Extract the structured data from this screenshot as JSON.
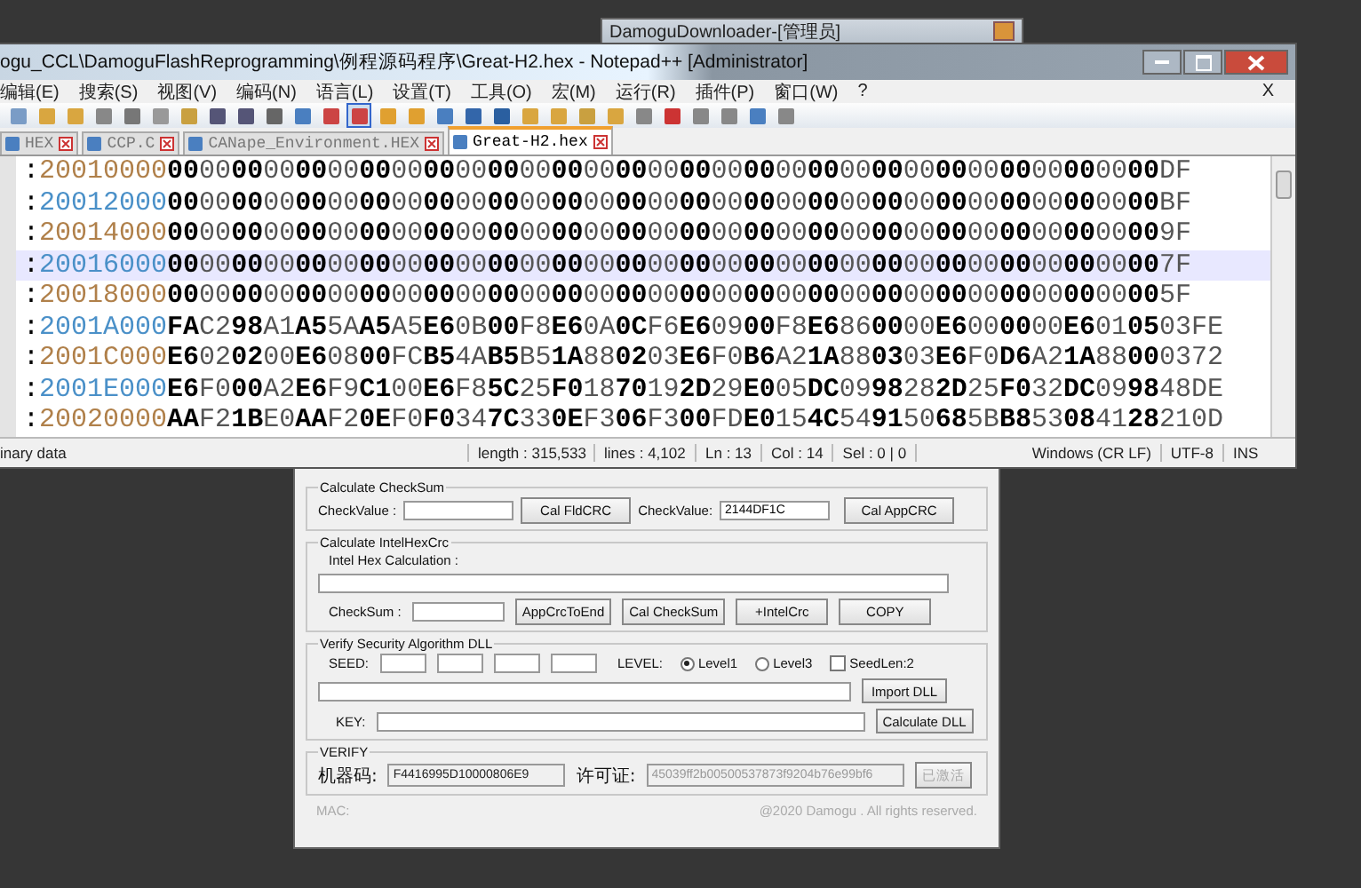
{
  "downloader_title": "DamoguDownloader-[管理员]",
  "notepad": {
    "title": "ogu_CCL\\DamoguFlashReprogramming\\例程源码程序\\Great-H2.hex - Notepad++ [Administrator]",
    "menu": [
      "编辑(E)",
      "搜索(S)",
      "视图(V)",
      "编码(N)",
      "语言(L)",
      "设置(T)",
      "工具(O)",
      "宏(M)",
      "运行(R)",
      "插件(P)",
      "窗口(W)",
      "?"
    ],
    "close_menu": "X",
    "tabs": [
      {
        "label": "HEX",
        "selected": false
      },
      {
        "label": "CCP.C",
        "selected": false
      },
      {
        "label": "CANape_Environment.HEX",
        "selected": false
      },
      {
        "label": "Great-H2.hex",
        "selected": true
      }
    ],
    "lines": [
      {
        "text": ":2001000000000000000000000000000000000000000000000000000000000000000000DF",
        "current": false
      },
      {
        "text": ":2001200000000000000000000000000000000000000000000000000000000000000000BF",
        "current": false
      },
      {
        "text": ":20014000000000000000000000000000000000000000000000000000000000000000009F",
        "current": false
      },
      {
        "text": ":20016000000000000000000000000000000000000000000000000000000000000000007F",
        "current": true
      },
      {
        "text": ":20018000000000000000000000000000000000000000000000000000000000000000005F",
        "current": false
      },
      {
        "text": ":2001A000FAC298A1A55AA5A5E60B00F8E60A0CF6E60900F8E6860000E6000000E6010503FE",
        "current": false
      },
      {
        "text": ":2001C000E6020200E60800FCB54AB5B51A880203E6F0B6A21A880303E6F0D6A21A88000372",
        "current": false
      },
      {
        "text": ":2001E000E6F000A2E6F9C100E6F85C25F01870192D29E005DC0998282D25F032DC099848DE",
        "current": false
      },
      {
        "text": ":20020000AAF21BE0AAF20EF0F0347C330EF306F300FDE0154C549150685BB853084128210D",
        "current": false
      }
    ],
    "status": [
      "inary data",
      "length : 315,533",
      "lines : 4,102",
      "Ln : 13",
      "Col : 14",
      "Sel : 0 | 0",
      "Windows (CR LF)",
      "UTF-8",
      "INS"
    ]
  },
  "downloader": {
    "checksum": {
      "title": "Calculate CheckSum",
      "label_1": "CheckValue :",
      "button_1": "Cal FldCRC",
      "label_2": "CheckValue:",
      "value_2": "2144DF1C",
      "button_2": "Cal AppCRC"
    },
    "intelhex": {
      "title": "Calculate IntelHexCrc",
      "label": "Intel Hex Calculation :",
      "checksum_label": "CheckSum :",
      "buttons": [
        "AppCrcToEnd",
        "Cal CheckSum",
        "+IntelCrc",
        "COPY"
      ]
    },
    "dll": {
      "title": "Verify Security Algorithm DLL",
      "seed_label": "SEED:",
      "level_label": "LEVEL:",
      "levels": [
        {
          "label": "Level1",
          "selected": true
        },
        {
          "label": "Level3",
          "selected": false
        }
      ],
      "seedlen": {
        "label": "SeedLen:2",
        "checked": false
      },
      "import_button": "Import DLL",
      "key_label": "KEY:",
      "calc_button": "Calculate DLL"
    },
    "verify": {
      "title": "VERIFY",
      "machine_label": "机器码:",
      "machine": "F4416995D10000806E9",
      "license_label": "许可证:",
      "license": "45039ff2b00500537873f9204b76e99bf6",
      "activate_button": "已激活",
      "activated": true
    },
    "mac": "MAC:",
    "copyright": "@2020  Damogu . All rights reserved."
  }
}
